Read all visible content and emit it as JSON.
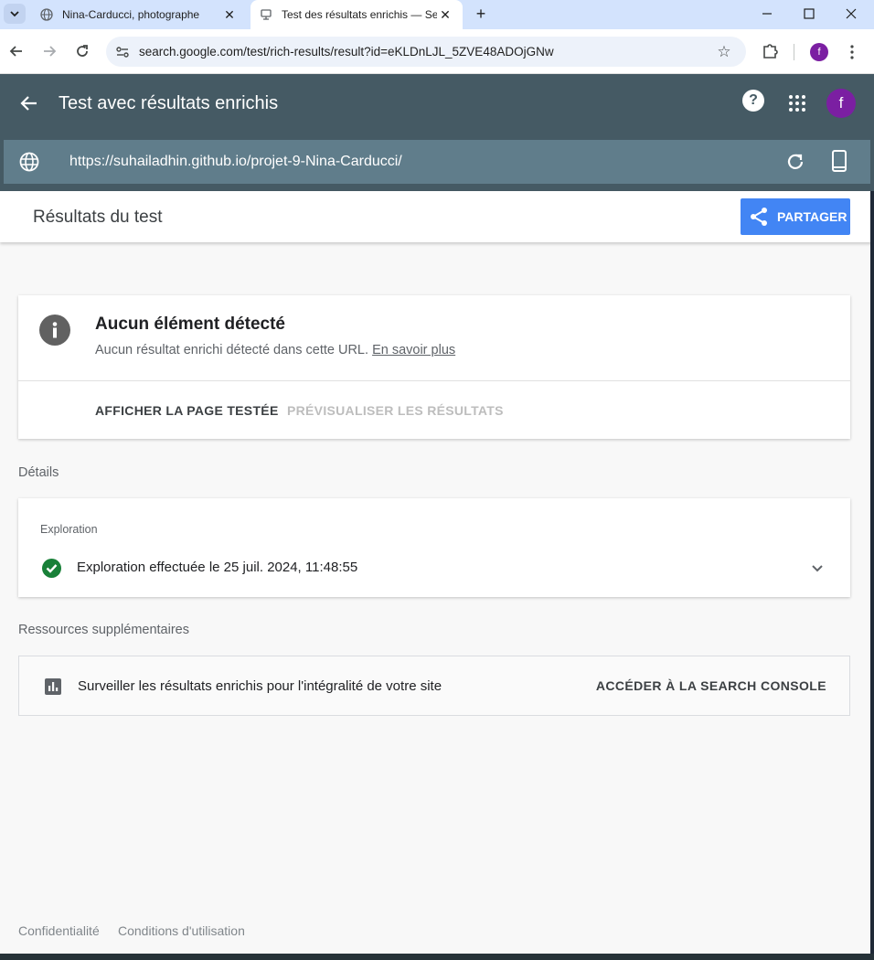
{
  "browser": {
    "tabs": [
      {
        "title": "Nina-Carducci, photographe",
        "active": false
      },
      {
        "title": "Test des résultats enrichis — Se",
        "active": true
      }
    ],
    "address_url": "search.google.com/test/rich-results/result?id=eKLDnLJL_5ZVE48ADOjGNw",
    "profile_initial": "f"
  },
  "app": {
    "title": "Test avec résultats enrichis",
    "help_symbol": "?",
    "account_initial": "f",
    "tested_url": "https://suhailadhin.github.io/projet-9-Nina-Carducci/"
  },
  "subheader": {
    "title": "Résultats du test",
    "share_label": "PARTAGER"
  },
  "result": {
    "title": "Aucun élément détecté",
    "description": "Aucun résultat enrichi détecté dans cette URL.",
    "learn_more": "En savoir plus",
    "view_tested_page": "AFFICHER LA PAGE TESTÉE",
    "preview_results": "PRÉVISUALISER LES RÉSULTATS"
  },
  "details": {
    "section_label": "Détails",
    "crawl_label": "Exploration",
    "crawl_status": "Exploration effectuée le 25 juil. 2024, 11:48:55"
  },
  "resources": {
    "section_label": "Ressources supplémentaires",
    "text": "Surveiller les résultats enrichis pour l'intégralité de votre site",
    "link": "ACCÉDER À LA SEARCH CONSOLE"
  },
  "footer": {
    "privacy": "Confidentialité",
    "terms": "Conditions d'utilisation"
  },
  "colors": {
    "appbar": "#455a64",
    "urlbar": "#607d8b",
    "share_button": "#4285f4",
    "avatar": "#7b1fa2",
    "success": "#188038"
  }
}
